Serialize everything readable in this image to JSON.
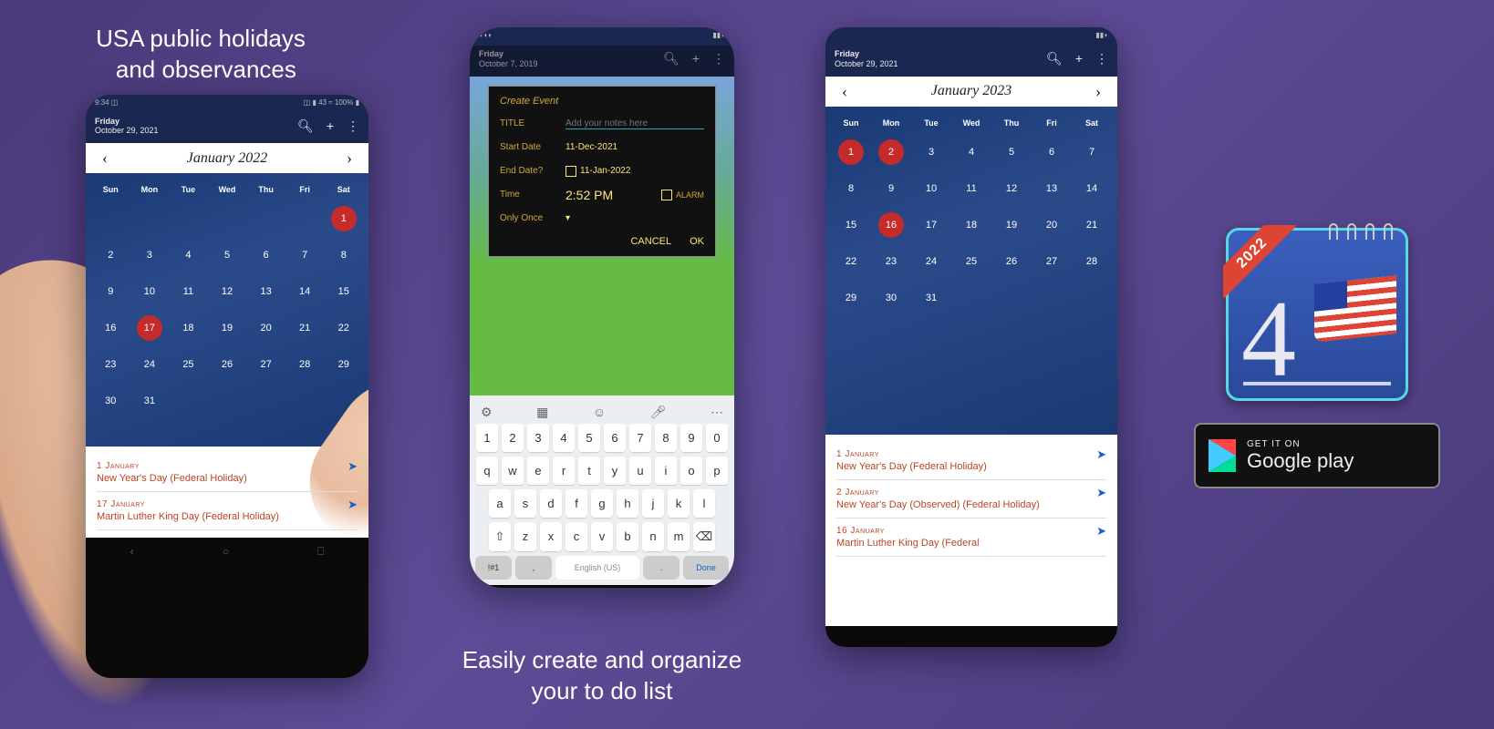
{
  "panel1": {
    "caption_line1": "USA public holidays",
    "caption_line2": "and observances",
    "status": {
      "left": "9:34 ◫",
      "right": "◫ ▮ 43 ≈ 100% ▮"
    },
    "header_dow": "Friday",
    "header_date": "October 29, 2021",
    "month_label": "January 2022",
    "dows": [
      "Sun",
      "Mon",
      "Tue",
      "Wed",
      "Thu",
      "Fri",
      "Sat"
    ],
    "weeks": [
      [
        "",
        "",
        "",
        "",
        "",
        "",
        "1"
      ],
      [
        "2",
        "3",
        "4",
        "5",
        "6",
        "7",
        "8"
      ],
      [
        "9",
        "10",
        "11",
        "12",
        "13",
        "14",
        "15"
      ],
      [
        "16",
        "17",
        "18",
        "19",
        "20",
        "21",
        "22"
      ],
      [
        "23",
        "24",
        "25",
        "26",
        "27",
        "28",
        "29"
      ],
      [
        "30",
        "31",
        "",
        "",
        "",
        "",
        ""
      ]
    ],
    "marked": [
      "1",
      "17"
    ],
    "events": [
      {
        "date": "1 January",
        "name": "New Year's Day (Federal Holiday)"
      },
      {
        "date": "17 January",
        "name": "Martin Luther King Day (Federal Holiday)"
      }
    ]
  },
  "panel2": {
    "caption_line1": "Easily create and organize",
    "caption_line2": "your to do list",
    "dialog": {
      "title": "Create Event",
      "title_label": "TITLE",
      "title_placeholder": "Add your notes here",
      "start_label": "Start Date",
      "start_value": "11-Dec-2021",
      "end_label": "End Date?",
      "end_value": "11-Jan-2022",
      "time_label": "Time",
      "time_value": "2:52 PM",
      "alarm_label": "ALARM",
      "once_label": "Only Once",
      "cancel": "CANCEL",
      "ok": "OK"
    },
    "key_rows": [
      [
        "1",
        "2",
        "3",
        "4",
        "5",
        "6",
        "7",
        "8",
        "9",
        "0"
      ],
      [
        "q",
        "w",
        "e",
        "r",
        "t",
        "y",
        "u",
        "i",
        "o",
        "p"
      ],
      [
        "a",
        "s",
        "d",
        "f",
        "g",
        "h",
        "j",
        "k",
        "l"
      ],
      [
        "⇧",
        "z",
        "x",
        "c",
        "v",
        "b",
        "n",
        "m",
        "⌫"
      ]
    ],
    "space_label": "English (US)",
    "sym_label": "!#1",
    "comma": ",",
    "period": ".",
    "done": "Done"
  },
  "panel3": {
    "header_dow": "Friday",
    "header_date": "October 29, 2021",
    "month_label": "January 2023",
    "dows": [
      "Sun",
      "Mon",
      "Tue",
      "Wed",
      "Thu",
      "Fri",
      "Sat"
    ],
    "weeks": [
      [
        "1",
        "2",
        "3",
        "4",
        "5",
        "6",
        "7"
      ],
      [
        "8",
        "9",
        "10",
        "11",
        "12",
        "13",
        "14"
      ],
      [
        "15",
        "16",
        "17",
        "18",
        "19",
        "20",
        "21"
      ],
      [
        "22",
        "23",
        "24",
        "25",
        "26",
        "27",
        "28"
      ],
      [
        "29",
        "30",
        "31",
        "",
        "",
        "",
        ""
      ]
    ],
    "marked": [
      "1",
      "2",
      "16"
    ],
    "events": [
      {
        "date": "1 January",
        "name": "New Year's Day (Federal Holiday)"
      },
      {
        "date": "2 January",
        "name": "New Year's Day (Observed) (Federal Holiday)"
      },
      {
        "date": "16 January",
        "name": "Martin Luther King Day (Federal"
      }
    ]
  },
  "panel4": {
    "ribbon": "2022",
    "digit": "4",
    "gp_small": "GET IT ON",
    "gp_big": "Google play"
  }
}
